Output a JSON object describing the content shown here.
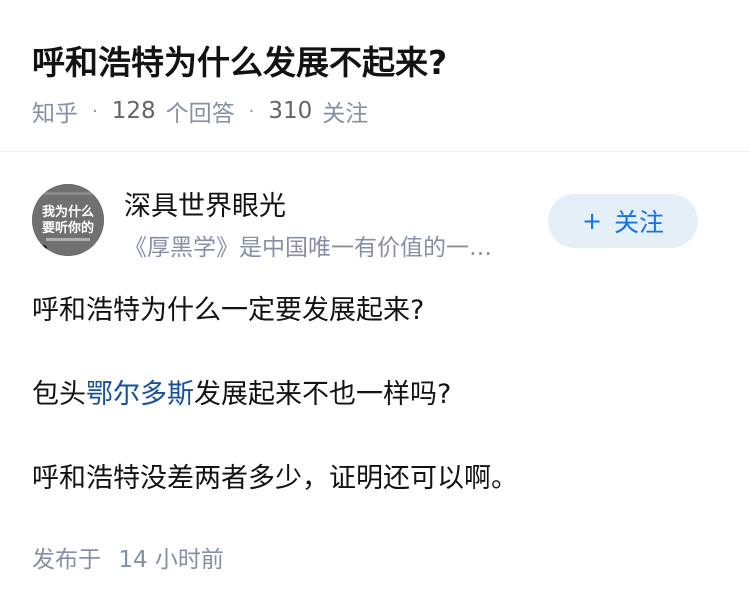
{
  "question": {
    "title": "呼和浩特为什么发展不起来?",
    "source": "知乎",
    "separator": "·",
    "answers_count": "128",
    "answers_label": "个回答",
    "followers_count": "310",
    "followers_label": "关注"
  },
  "author": {
    "name": "深具世界眼光",
    "bio": "《厚黑学》是中国唯一有价值的一…",
    "avatar_text_line1": "我为什么",
    "avatar_text_line2": "要听你的",
    "follow_plus": "+",
    "follow_label": "关注"
  },
  "body": {
    "line1": "呼和浩特为什么一定要发展起来?",
    "line2_prefix": "包头",
    "line2_link": "鄂尔多斯",
    "line2_suffix": "发展起来不也一样吗?",
    "line3": "呼和浩特没差两者多少，证明还可以啊。"
  },
  "footer": {
    "posted_label": "发布于",
    "posted_time": "14 小时前"
  },
  "colors": {
    "link": "#175199",
    "meta": "#8590a6",
    "follow_bg": "#e5eff8",
    "follow_text": "#1771e6"
  }
}
